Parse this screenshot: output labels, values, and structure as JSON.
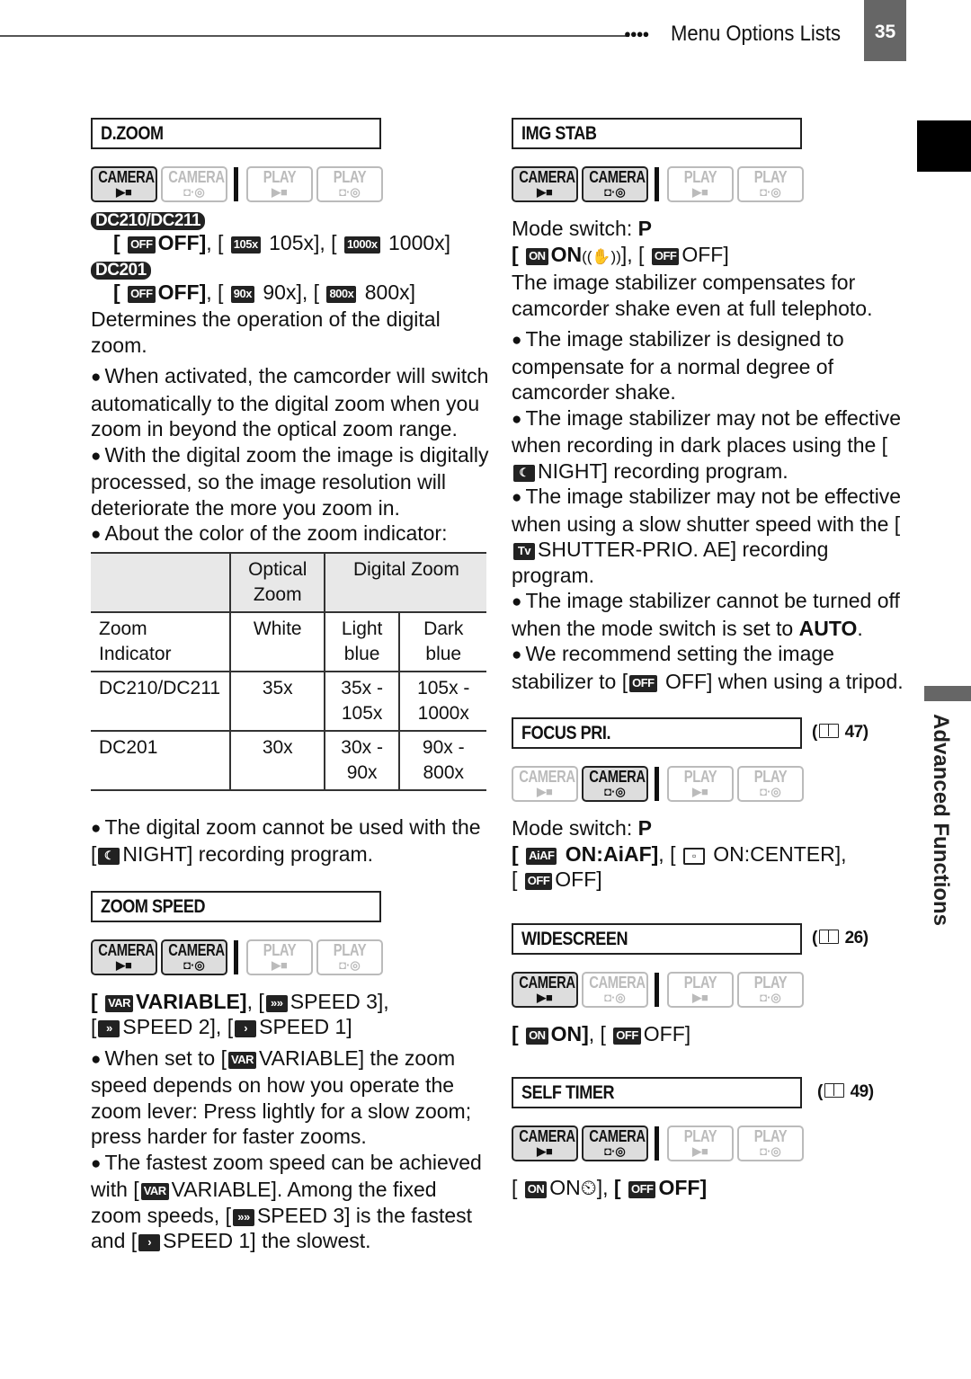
{
  "header": {
    "dots": "●●●●",
    "title": "Menu Options Lists",
    "page_number": "35"
  },
  "side_tab": {
    "label": "Advanced Functions"
  },
  "mode_labels": {
    "camera": "CAMERA",
    "play": "PLAY",
    "movie_icon": "▶■",
    "still_icon": "◘·◎"
  },
  "dzoom": {
    "title": "D.ZOOM",
    "modes": {
      "camera_movie": true,
      "camera_still": false,
      "play_movie": false,
      "play_still": false
    },
    "models": [
      {
        "badge": "DC210/DC211",
        "options": [
          {
            "icon": "OFF",
            "label": "OFF",
            "bold": true
          },
          {
            "icon": "105x",
            "label": "105x",
            "bold": false
          },
          {
            "icon": "1000x",
            "label": "1000x",
            "bold": false
          }
        ]
      },
      {
        "badge": "DC201",
        "options": [
          {
            "icon": "OFF",
            "label": "OFF",
            "bold": true
          },
          {
            "icon": "90x",
            "label": "90x",
            "bold": false
          },
          {
            "icon": "800x",
            "label": "800x",
            "bold": false
          }
        ]
      }
    ],
    "description": "Determines the operation of the digital zoom.",
    "bullets": [
      "When activated, the camcorder will switch automatically to the digital zoom when you zoom in beyond the optical zoom range.",
      "With the digital zoom the image is digitally processed, so the image resolution will deteriorate the more you zoom in.",
      "About the color of the zoom indicator:"
    ],
    "table": {
      "header": [
        "",
        "Optical Zoom",
        "Digital Zoom"
      ],
      "rows": [
        [
          "Zoom Indicator",
          "White",
          "Light blue",
          "Dark blue"
        ],
        [
          "DC210/DC211",
          "35x",
          "35x - 105x",
          "105x - 1000x"
        ],
        [
          "DC201",
          "30x",
          "30x - 90x",
          "90x - 800x"
        ]
      ]
    },
    "note_pre": "The digital zoom cannot be used with the [",
    "note_icon": "night-icon",
    "note_post": "NIGHT] recording program."
  },
  "zoom_speed": {
    "title": "ZOOM SPEED",
    "modes": {
      "camera_movie": true,
      "camera_still": true,
      "play_movie": false,
      "play_still": false
    },
    "options": [
      {
        "icon": "VAR",
        "label": "VARIABLE",
        "bold": true
      },
      {
        "icon": "»»",
        "label": "SPEED 3",
        "bold": false
      },
      {
        "icon": "»",
        "label": "SPEED 2",
        "bold": false
      },
      {
        "icon": "›",
        "label": "SPEED 1",
        "bold": false
      }
    ],
    "bullet1": {
      "pre": "When set to [",
      "icon": "VAR",
      "post": "VARIABLE] the zoom speed depends on how you operate the zoom lever: Press lightly for a slow zoom; press harder for faster zooms."
    },
    "bullet2": {
      "a": "The fastest zoom speed can be achieved with [",
      "icon1": "VAR",
      "b": "VARIABLE]. Among the fixed zoom speeds, [",
      "icon2": "»»",
      "c": "SPEED 3] is the fastest and [",
      "icon3": "›",
      "d": "SPEED 1] the slowest."
    }
  },
  "img_stab": {
    "title": "IMG STAB",
    "modes": {
      "camera_movie": true,
      "camera_still": true,
      "play_movie": false,
      "play_still": false
    },
    "mode_switch_label": "Mode switch: ",
    "mode_switch_value": "P",
    "options": [
      {
        "icon": "ON",
        "label": "ON",
        "suffix": "((✋))",
        "bold": true
      },
      {
        "icon": "OFF",
        "label": "OFF",
        "bold": false
      }
    ],
    "description": "The image stabilizer compensates for camcorder shake even at full telephoto.",
    "bullets": [
      {
        "text": "The image stabilizer is designed to compensate for a normal degree of camcorder shake."
      },
      {
        "pre": "The image stabilizer may not be effective when recording in dark places using the [",
        "icon": "night-icon",
        "post": "NIGHT] recording program."
      },
      {
        "pre": "The image stabilizer may not be effective when using a slow shutter speed with the [",
        "icon": "Tv",
        "post": "SHUTTER-PRIO. AE] recording program."
      },
      {
        "pre": "The image stabilizer cannot be turned off when the mode switch is set to ",
        "bold": "AUTO",
        "post": "."
      },
      {
        "pre": "We recommend setting the image stabilizer to [",
        "icon": "OFF",
        "post": " OFF] when using a tripod."
      }
    ]
  },
  "focus_pri": {
    "title": "FOCUS PRI.",
    "ref": "47",
    "modes": {
      "camera_movie": false,
      "camera_still": true,
      "play_movie": false,
      "play_still": false
    },
    "mode_switch_label": "Mode switch: ",
    "mode_switch_value": "P",
    "options": [
      {
        "icon": "AiAF",
        "label": "ON:AiAF",
        "bold": true
      },
      {
        "icon": "center-frame-icon",
        "label": "ON:CENTER",
        "bold": false
      },
      {
        "icon": "OFF",
        "label": "OFF",
        "bold": false
      }
    ]
  },
  "widescreen": {
    "title": "WIDESCREEN",
    "ref": "26",
    "modes": {
      "camera_movie": true,
      "camera_still": false,
      "play_movie": false,
      "play_still": false
    },
    "options": [
      {
        "icon": "ON",
        "label": "ON",
        "bold": true
      },
      {
        "icon": "OFF",
        "label": "OFF",
        "bold": false
      }
    ]
  },
  "self_timer": {
    "title": "SELF TIMER",
    "ref": "49",
    "modes": {
      "camera_movie": true,
      "camera_still": true,
      "play_movie": false,
      "play_still": false
    },
    "options": [
      {
        "icon": "ON",
        "label": "ON",
        "suffix": "⏲",
        "bold": false
      },
      {
        "icon": "OFF",
        "label": "OFF",
        "bold": true
      }
    ]
  }
}
